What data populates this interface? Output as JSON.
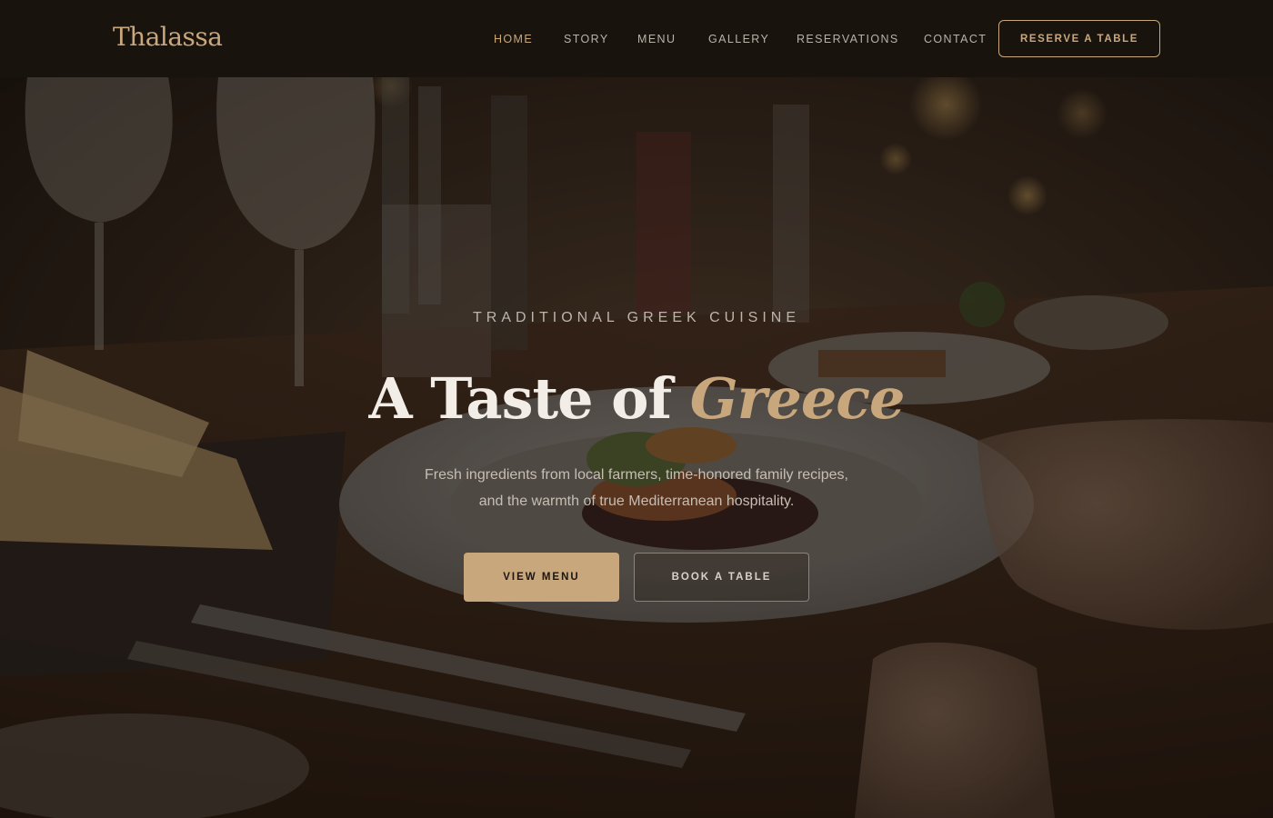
{
  "header": {
    "logo": "Thalassa",
    "nav": [
      {
        "label": "HOME",
        "active": true
      },
      {
        "label": "STORY",
        "active": false
      },
      {
        "label": "MENU",
        "active": false
      },
      {
        "label": "GALLERY",
        "active": false
      },
      {
        "label": "RESERVATIONS",
        "active": false
      },
      {
        "label": "CONTACT",
        "active": false
      }
    ],
    "cta_label": "RESERVE A TABLE"
  },
  "hero": {
    "eyebrow": "TRADITIONAL GREEK CUISINE",
    "title_main": "A Taste of",
    "title_accent": "Greece",
    "subtitle_line1": "Fresh ingredients from local farmers, time-honored family recipes,",
    "subtitle_line2": "and the warmth of true Mediterranean hospitality.",
    "primary_button": "VIEW MENU",
    "secondary_button": "BOOK A TABLE"
  },
  "colors": {
    "header_bg": "#19130e",
    "accent_gold": "#c9a77c",
    "nav_text": "#b9b2a8",
    "hero_title": "#f2ede6"
  },
  "icons": [
    "restaurant-dining-photo"
  ]
}
